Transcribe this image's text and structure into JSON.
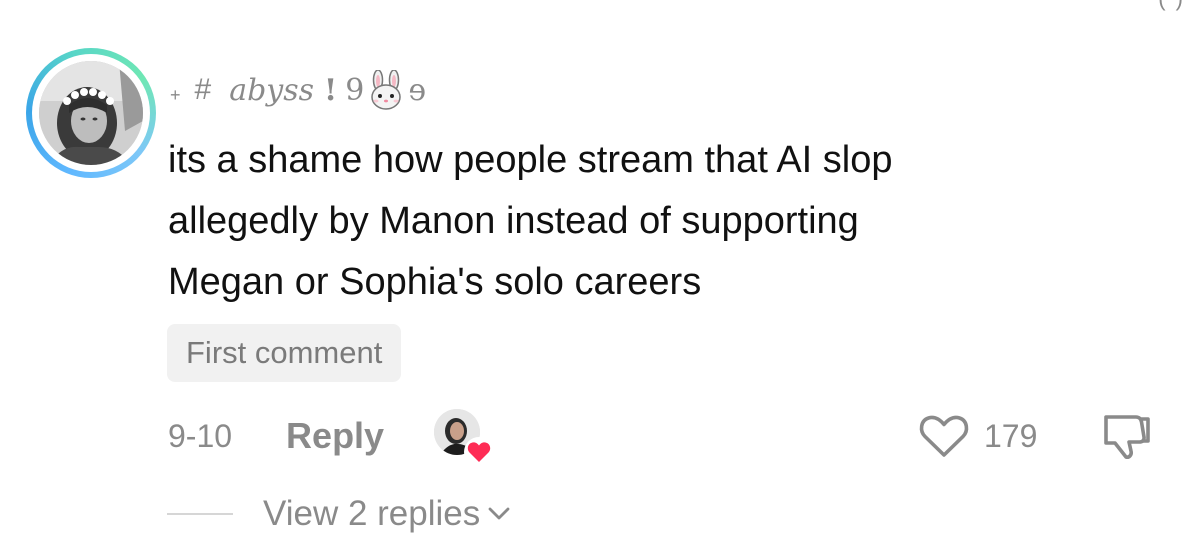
{
  "comment": {
    "author": {
      "prefix_plus": "+",
      "prefix_hash": "#",
      "name": "abyss",
      "bang": "!",
      "nine": "9",
      "emoji": "bunny-face-icon",
      "tail": "ɘ"
    },
    "text": "its a shame how people stream that AI slop\nallegedly by Manon instead of supporting\nMegan or Sophia's solo careers",
    "badge": "First comment",
    "date": "9-10",
    "reply_label": "Reply",
    "like_count": "179",
    "view_replies_label": "View 2 replies"
  },
  "colors": {
    "avatar_ring_start": "#60b8ff",
    "avatar_ring_end": "#6fe7b4",
    "muted_text": "#8a8a8a",
    "badge_bg": "#f1f1f1",
    "heart_badge": "#fe2c55"
  }
}
